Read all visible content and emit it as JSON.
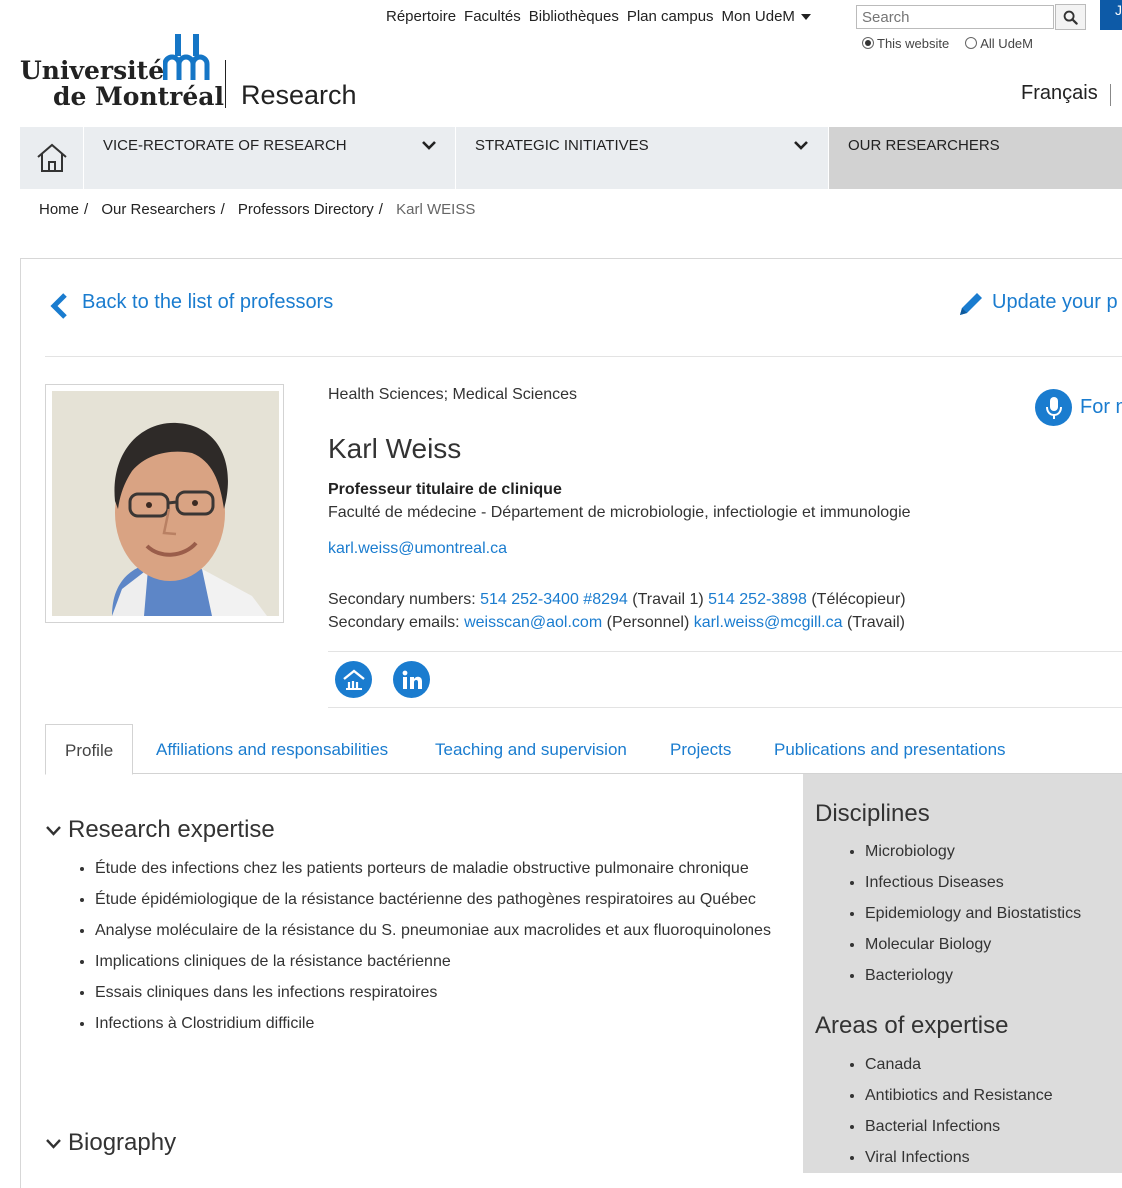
{
  "topnav": {
    "items": [
      "Répertoire",
      "Facultés",
      "Bibliothèques",
      "Plan campus",
      "Mon UdeM"
    ],
    "search_placeholder": "Search",
    "radio_site": "This website",
    "radio_all": "All UdeM",
    "edge_text": "Je"
  },
  "header": {
    "logo_line1": "Université",
    "logo_line2": "de Montréal",
    "section": "Research",
    "language": "Français"
  },
  "mainnav": {
    "items": [
      "VICE-RECTORATE OF RESEARCH",
      "STRATEGIC INITIATIVES",
      "OUR RESEARCHERS"
    ]
  },
  "breadcrumb": {
    "items": [
      "Home",
      "Our Researchers",
      "Professors Directory"
    ],
    "current": "Karl WEISS",
    "separator": "/"
  },
  "profile": {
    "back_link": "Back to the list of professors",
    "update_link": "Update your p",
    "disciplines_line": "Health Sciences; Medical Sciences",
    "name": "Karl Weiss",
    "title": "Professeur titulaire de clinique",
    "faculty": "Faculté de médecine - Département de microbiologie, infectiologie et immunologie",
    "email": "karl.weiss@umontreal.ca",
    "secondary_numbers_label": "Secondary numbers:",
    "phone1": "514 252-3400 #8294",
    "phone1_note": "(Travail 1)",
    "phone2": "514 252-3898",
    "phone2_note": "(Télécopieur)",
    "secondary_emails_label": "Secondary emails:",
    "email2": "weisscan@aol.com",
    "email2_note": "(Personnel)",
    "email3": "karl.weiss@mcgill.ca",
    "email3_note": "(Travail)",
    "media_link": "For m"
  },
  "tabs": [
    "Profile",
    "Affiliations and responsabilities",
    "Teaching and supervision",
    "Projects",
    "Publications and presentations"
  ],
  "research_expertise": {
    "heading": "Research expertise",
    "items": [
      "Étude des infections chez les patients porteurs de maladie obstructive pulmonaire chronique",
      "Étude épidémiologique de la résistance bactérienne des pathogènes respiratoires au Québec",
      "Analyse moléculaire de la résistance du S. pneumoniae aux macrolides et aux fluoroquinolones",
      "Implications cliniques de la résistance bactérienne",
      "Essais cliniques dans les infections respiratoires",
      "Infections à Clostridium difficile"
    ]
  },
  "biography": {
    "heading": "Biography"
  },
  "sidebar": {
    "disciplines_heading": "Disciplines",
    "disciplines": [
      "Microbiology",
      "Infectious Diseases",
      "Epidemiology and Biostatistics",
      "Molecular Biology",
      "Bacteriology"
    ],
    "areas_heading": "Areas of expertise",
    "areas": [
      "Canada",
      "Antibiotics and Resistance",
      "Bacterial Infections",
      "Viral Infections"
    ]
  },
  "colors": {
    "link": "#1a7ccf",
    "nav_bg": "#eaedf0",
    "sidebar_bg": "#dcdcdc",
    "brand_blue": "#0d5aa7"
  }
}
